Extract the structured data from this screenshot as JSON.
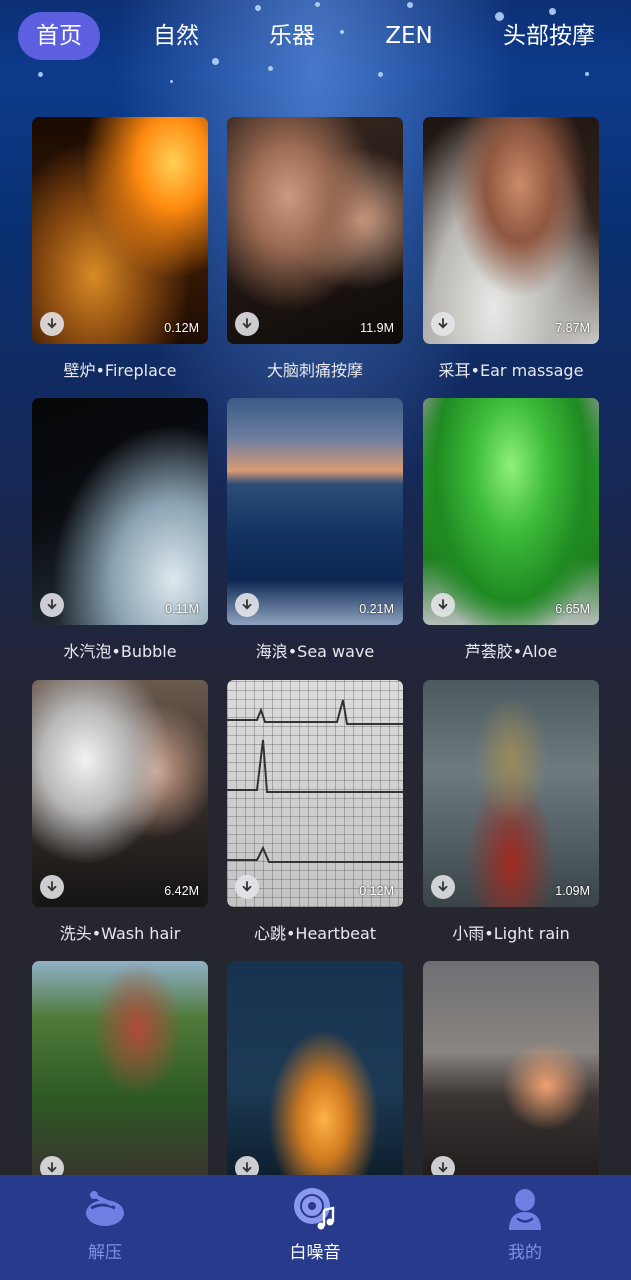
{
  "top_tabs": [
    {
      "label": "首页",
      "active": true
    },
    {
      "label": "自然",
      "active": false
    },
    {
      "label": "乐器",
      "active": false
    },
    {
      "label": "ZEN",
      "active": false
    },
    {
      "label": "头部按摩",
      "active": false
    }
  ],
  "sounds": [
    {
      "title": "壁炉•Fireplace",
      "size": "0.12M",
      "image": "fireplace-teapot"
    },
    {
      "title": "大脑刺痛按摩",
      "size": "11.9M",
      "image": "head-massage"
    },
    {
      "title": "采耳•Ear massage",
      "size": "7.87M",
      "image": "ear"
    },
    {
      "title": "水汽泡•Bubble",
      "size": "0.11M",
      "image": "bubbles"
    },
    {
      "title": "海浪•Sea wave",
      "size": "0.21M",
      "image": "sea-wave"
    },
    {
      "title": "芦荟胶•Aloe",
      "size": "6.65M",
      "image": "aloe-gel"
    },
    {
      "title": "洗头•Wash hair",
      "size": "6.42M",
      "image": "wash-hair"
    },
    {
      "title": "心跳•Heartbeat",
      "size": "0.12M",
      "image": "heartbeat-ecg"
    },
    {
      "title": "小雨•Light rain",
      "size": "1.09M",
      "image": "rain-big-ben"
    },
    {
      "title": "",
      "size": "",
      "image": "palace-forest"
    },
    {
      "title": "",
      "size": "",
      "image": "tent-night"
    },
    {
      "title": "",
      "size": "",
      "image": "coast-sunset"
    }
  ],
  "bottom_nav": [
    {
      "label": "解压",
      "icon": "relax-icon",
      "active": false
    },
    {
      "label": "白噪音",
      "icon": "music-disc-icon",
      "active": true
    },
    {
      "label": "我的",
      "icon": "user-icon",
      "active": false
    }
  ],
  "colors": {
    "active_tab_bg": "#5b5fe0",
    "nav_bg": "#273a8c",
    "nav_inactive": "#7f8ee6",
    "page_bg": "#26262e"
  }
}
